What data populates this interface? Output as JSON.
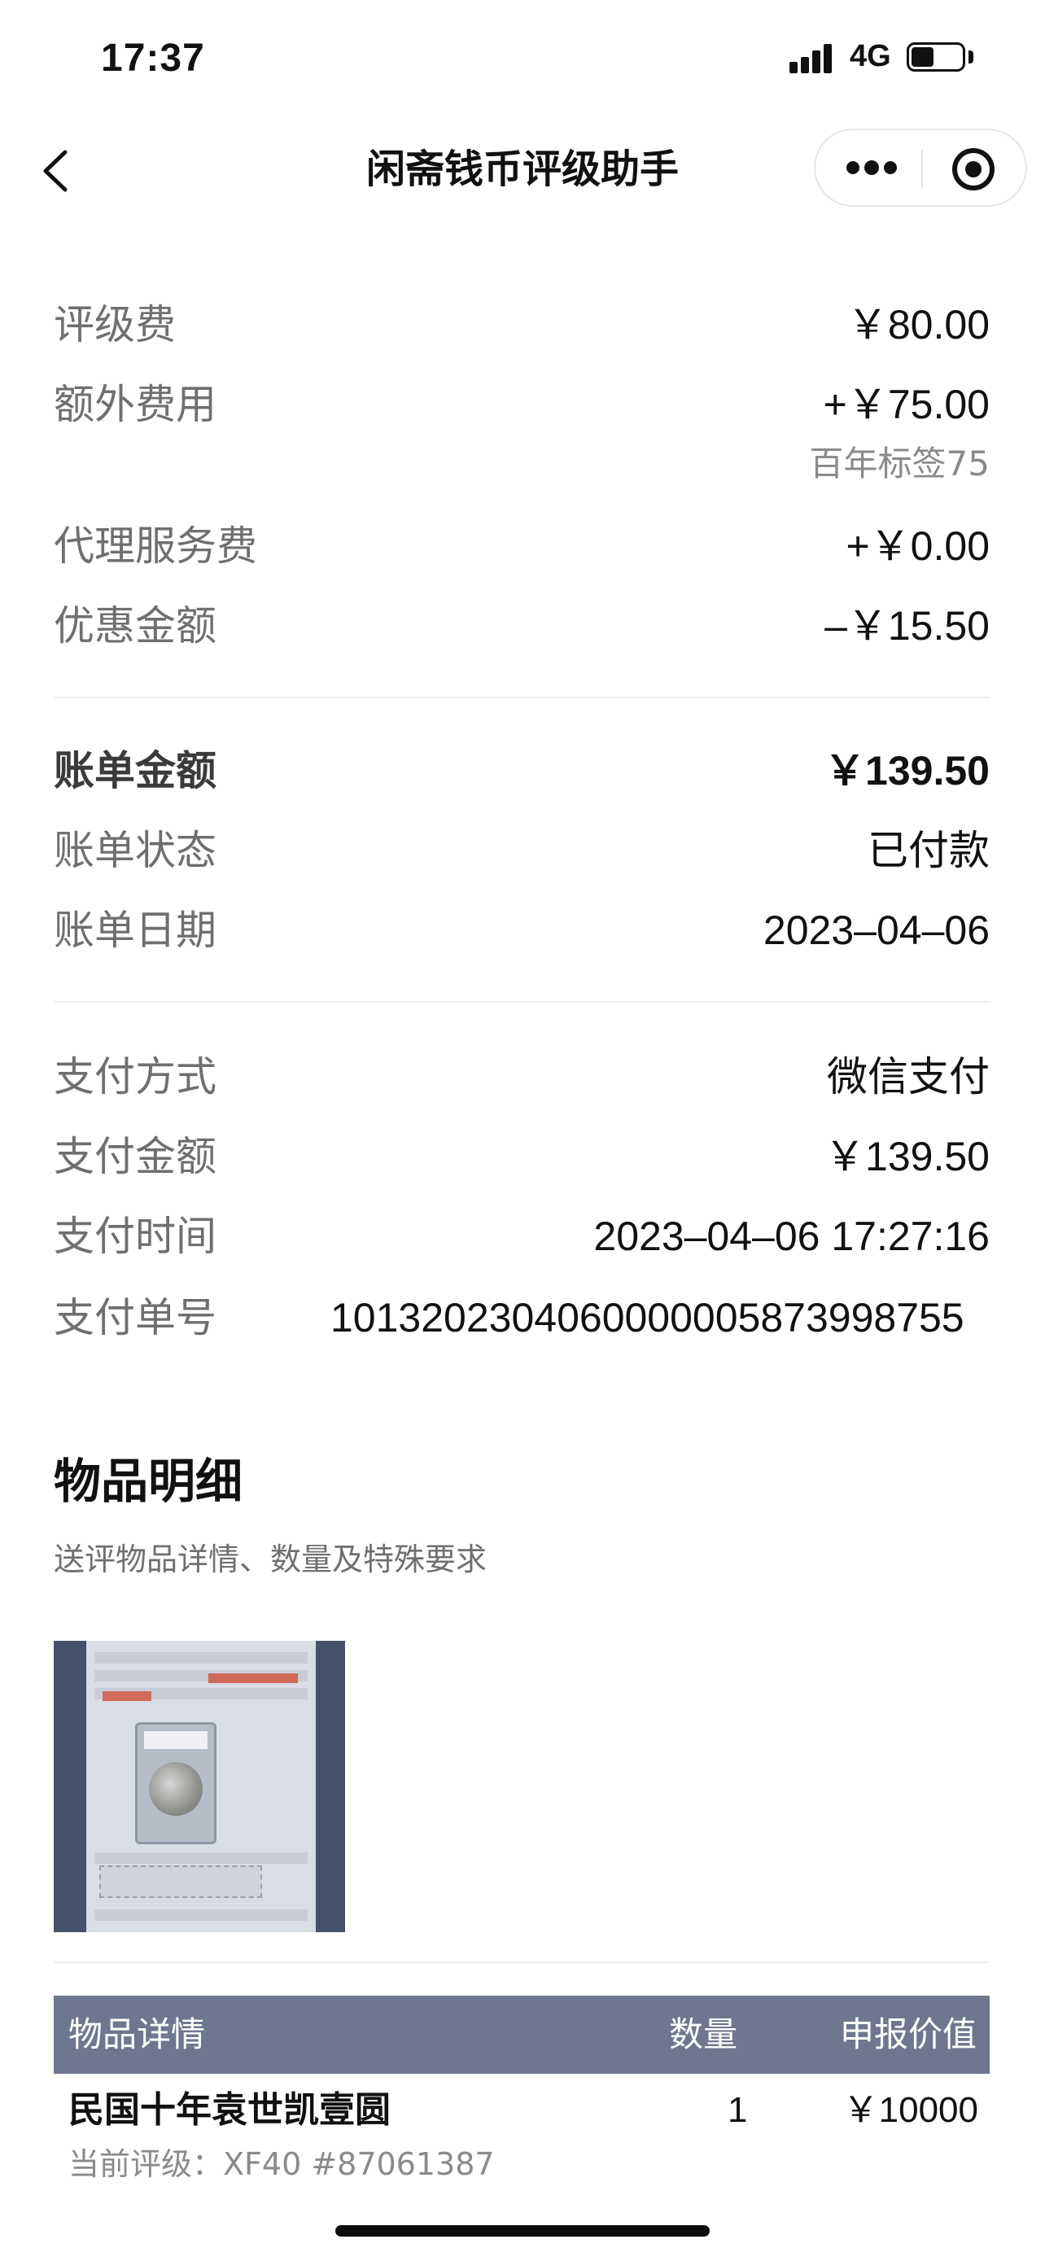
{
  "status_bar": {
    "time": "17:37",
    "network": "4G",
    "battery_level": 0.45
  },
  "nav": {
    "title": "闲斋钱币评级助手",
    "back_icon": "chevron-left-icon",
    "more_icon": "more-dots-icon",
    "target_icon": "target-circle-icon"
  },
  "fees": {
    "grading_fee_label": "评级费",
    "grading_fee_value": "￥80.00",
    "extra_fee_label": "额外费用",
    "extra_fee_value": "+￥75.00",
    "extra_fee_note": "百年标签75",
    "agency_fee_label": "代理服务费",
    "agency_fee_value": "+￥0.00",
    "discount_label": "优惠金额",
    "discount_value": "–￥15.50"
  },
  "bill": {
    "amount_label": "账单金额",
    "amount_value": "￥139.50",
    "status_label": "账单状态",
    "status_value": "已付款",
    "date_label": "账单日期",
    "date_value": "2023–04–06"
  },
  "payment": {
    "method_label": "支付方式",
    "method_value": "微信支付",
    "amount_label": "支付金额",
    "amount_value": "￥139.50",
    "time_label": "支付时间",
    "time_value": "2023–04–06 17:27:16",
    "number_label": "支付单号",
    "number_value": "1013202304060000005873998755"
  },
  "items_section": {
    "title": "物品明细",
    "subtitle": "送评物品详情、数量及特殊要求",
    "table_headers": {
      "detail": "物品详情",
      "quantity": "数量",
      "declared_value": "申报价值"
    },
    "rows": [
      {
        "name": "民国十年袁世凯壹圆",
        "quantity": "1",
        "declared_value": "￥10000",
        "grade": "当前评级：XF40 #87061387"
      }
    ]
  },
  "colors": {
    "table_header_bg": "#6f7690",
    "label_gray": "#6f6f6f",
    "note_gray": "#8a8a8a"
  }
}
